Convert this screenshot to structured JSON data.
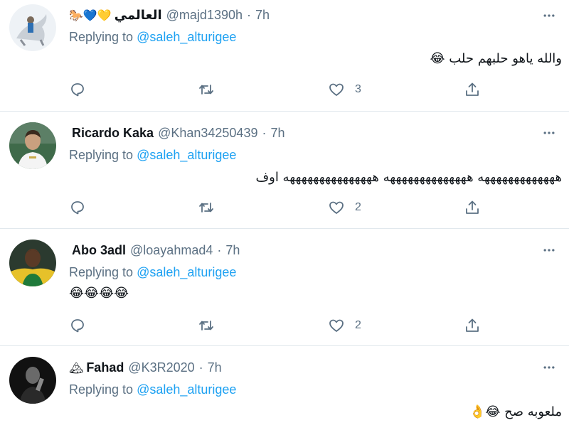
{
  "tweets": [
    {
      "name": "العالمي",
      "name_emojis": "🐎💙💛",
      "handle": "@majd1390h",
      "separator": "·",
      "time": "7h",
      "replying_label": "Replying to",
      "replying_to": "@saleh_alturigee",
      "text": "والله ياهو حلبهم حلب 😂",
      "text_dir": "rtl",
      "reply_count": "",
      "retweet_count": "",
      "like_count": "3"
    },
    {
      "name": "Ricardo Kaka",
      "name_emojis": "",
      "handle": "@Khan34250439",
      "separator": "·",
      "time": "7h",
      "replying_label": "Replying to",
      "replying_to": "@saleh_alturigee",
      "text": "هههههههههههههه ههههههههههههههه هههههههههههههههه اوف",
      "text_dir": "rtl",
      "reply_count": "",
      "retweet_count": "",
      "like_count": "2"
    },
    {
      "name": "Abo 3adl",
      "name_emojis": "",
      "handle": "@loayahmad4",
      "separator": "·",
      "time": "7h",
      "replying_label": "Replying to",
      "replying_to": "@saleh_alturigee",
      "text": "😂😂😂😂",
      "text_dir": "ltr",
      "reply_count": "",
      "retweet_count": "",
      "like_count": "2"
    },
    {
      "name": "Fahad",
      "name_emojis": "🏔",
      "handle": "@K3R2020",
      "separator": "·",
      "time": "7h",
      "replying_label": "Replying to",
      "replying_to": "@saleh_alturigee",
      "text": "ملعوبه صح 😂👌",
      "text_dir": "rtl",
      "reply_count": "",
      "retweet_count": "",
      "like_count": ""
    }
  ],
  "icons": {
    "reply": "reply-icon",
    "retweet": "retweet-icon",
    "like": "like-icon",
    "share": "share-icon",
    "more": "more-icon"
  },
  "colors": {
    "link": "#1da1f2",
    "secondary_text": "#5b7083",
    "divider": "#e1e8ed"
  }
}
